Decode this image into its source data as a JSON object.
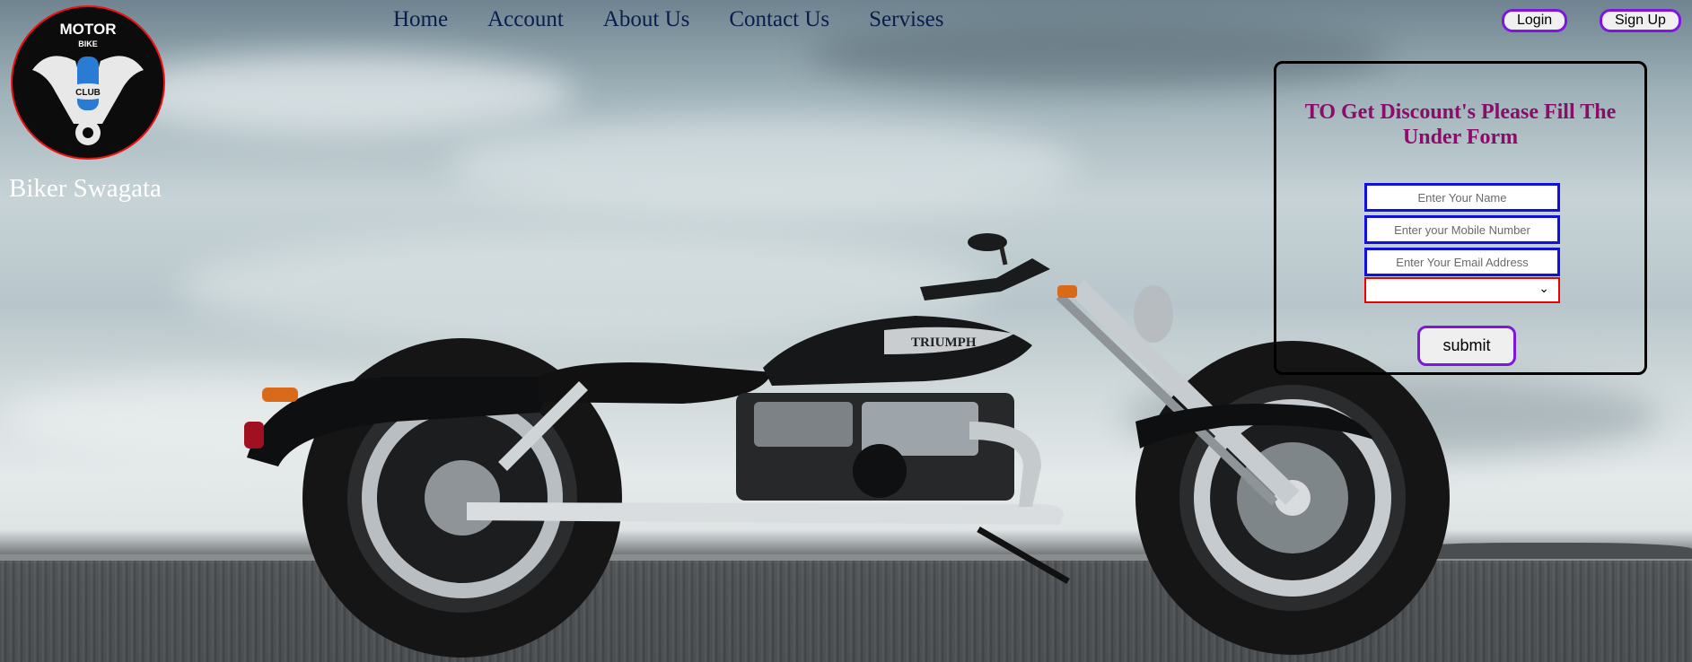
{
  "brand": {
    "name": "Biker Swagata",
    "logo_text_top": "MOTOR",
    "logo_text_mid": "BIKE",
    "logo_text_bottom": "CLUB"
  },
  "nav": {
    "items": [
      "Home",
      "Account",
      "About Us",
      "Contact Us",
      "Servises"
    ]
  },
  "auth": {
    "login_label": "Login",
    "signup_label": "Sign Up"
  },
  "form": {
    "title": "TO Get Discount's Please Fill The Under Form",
    "name_placeholder": "Enter Your Name",
    "mobile_placeholder": "Enter your Mobile Number",
    "email_placeholder": "Enter Your Email Address",
    "select_value": "",
    "submit_label": "submit"
  },
  "bike": {
    "badge": "TRIUMPH"
  },
  "colors": {
    "accent": "#7d17e0",
    "title": "#8b0d6a",
    "field_border": "#1010e0",
    "select_border": "#e00000"
  }
}
